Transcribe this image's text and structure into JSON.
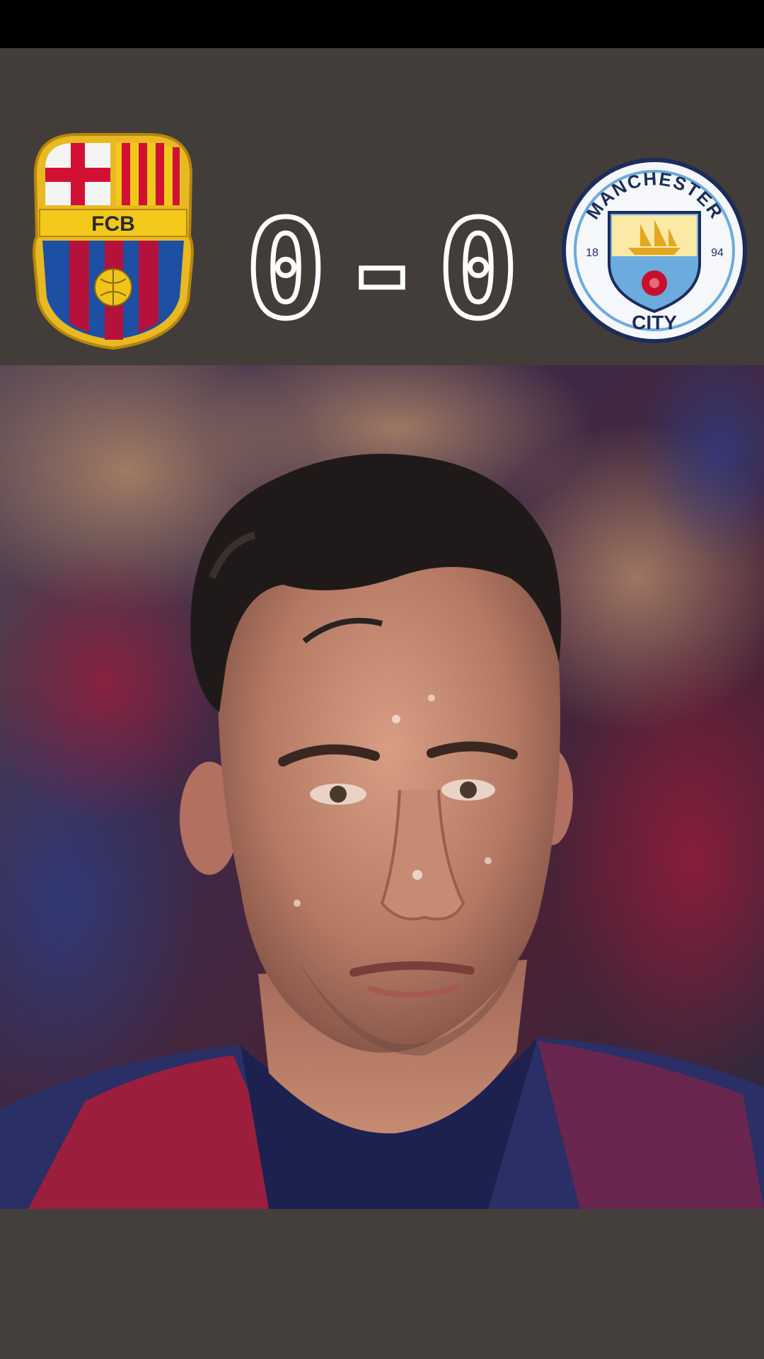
{
  "scoreboard": {
    "home": {
      "crest_text": "FCB",
      "icon": "fc-barcelona-crest-icon",
      "colors": {
        "blue": "#1d4fa3",
        "red": "#b5123b",
        "gold": "#f0c419"
      }
    },
    "away": {
      "crest_top_text": "MANCHESTER",
      "crest_bottom_text": "CITY",
      "year_left": "18",
      "year_right": "94",
      "icon": "manchester-city-crest-icon",
      "colors": {
        "sky": "#6cabdd",
        "navy": "#1c2c5b"
      }
    },
    "home_score": "0",
    "separator": "-",
    "away_score": "0",
    "score_color": "#ffffff"
  },
  "video": {
    "content": "player-closeup"
  }
}
